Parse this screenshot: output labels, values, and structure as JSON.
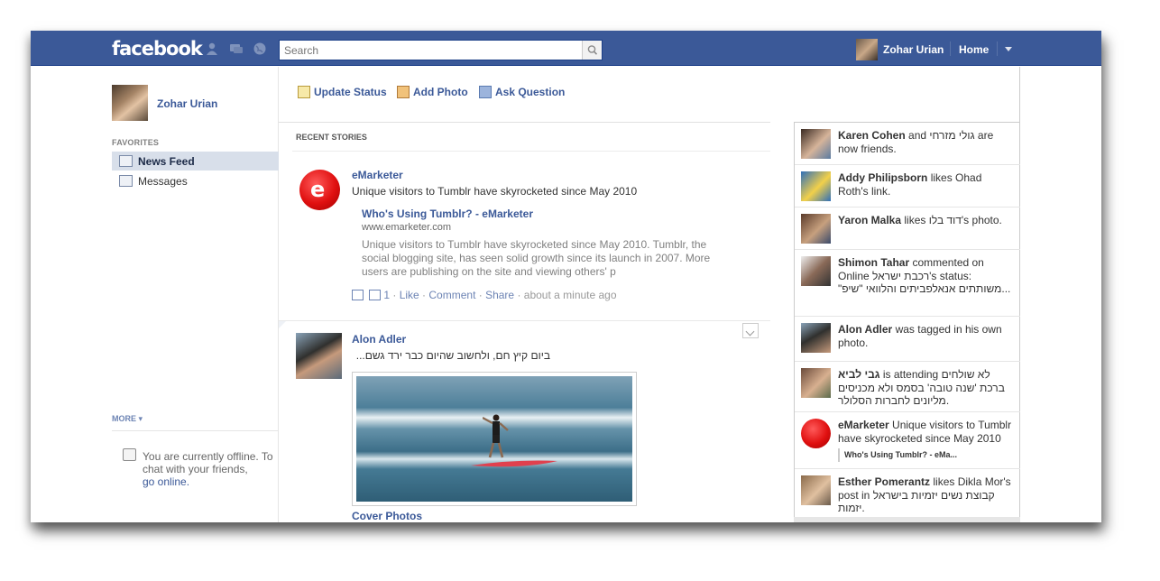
{
  "header": {
    "logo": "facebook",
    "search_placeholder": "Search",
    "username": "Zohar Urian",
    "home": "Home"
  },
  "left": {
    "profile_name": "Zohar Urian",
    "favorites_header": "FAVORITES",
    "nav": [
      {
        "label": "News Feed",
        "selected": true
      },
      {
        "label": "Messages",
        "selected": false
      }
    ],
    "more": "MORE",
    "chat_status": "You are currently offline. To chat with your friends,",
    "chat_link": "go online."
  },
  "composer": {
    "items": [
      {
        "label": "Update Status"
      },
      {
        "label": "Add Photo"
      },
      {
        "label": "Ask Question"
      }
    ]
  },
  "feed": {
    "header": "RECENT STORIES",
    "stories": [
      {
        "actor": "eMarketer",
        "message": "Unique visitors to Tumblr have skyrocketed since May 2010",
        "link_title": "Who's Using Tumblr? - eMarketer",
        "link_url": "www.emarketer.com",
        "link_description": "Unique visitors to Tumblr have skyrocketed since May 2010. Tumblr, the social blogging site, has seen solid growth since its launch in 2007. More users are publishing on the site and viewing others' p",
        "comment_count": "1",
        "like": "Like",
        "comment": "Comment",
        "share": "Share",
        "time": "about a minute ago"
      },
      {
        "actor": "Alon Adler",
        "message": "ביום קיץ חם, ולחשוב שהיום כבר ירד גשם...",
        "album": "Cover Photos"
      }
    ]
  },
  "ticker": {
    "items": [
      {
        "actor": "Karen Cohen",
        "rest": "and גולי מזרחי are now friends."
      },
      {
        "actor": "Addy Philipsborn",
        "rest": "likes Ohad Roth's link."
      },
      {
        "actor": "Yaron Malka",
        "rest": "likes דוד בלו's photo."
      },
      {
        "actor": "Shimon Tahar",
        "rest": "commented on Online רכבת ישראל's status: \"משותתים אנאלפביתים והלוואי \"שיפ..."
      },
      {
        "actor": "Alon Adler",
        "rest": "was tagged in his own photo."
      },
      {
        "actor": "גבי לביא",
        "rest": "is attending לא שולחים ברכת 'שנה טובה' בסמס ולא מכניסים מליונים לחברות הסלולר."
      },
      {
        "actor": "eMarketer",
        "rest": "Unique visitors to Tumblr have skyrocketed since May 2010",
        "sublink": "Who's Using Tumblr? - eMa..."
      },
      {
        "actor": "Esther Pomerantz",
        "rest": "likes Dikla Mor's post in קבוצת נשים יזמיות בישראל יזמות."
      }
    ]
  }
}
